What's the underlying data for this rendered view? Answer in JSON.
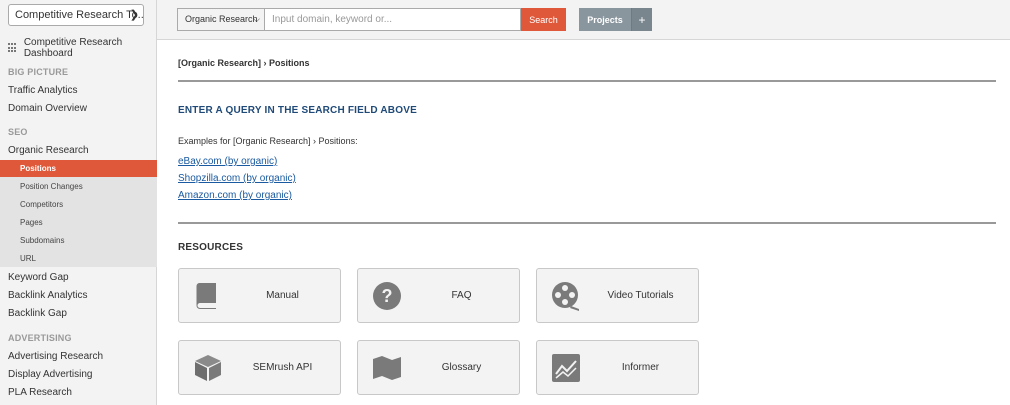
{
  "sidebar": {
    "tool_select": "Competitive Research To...",
    "dashboard": "Competitive Research Dashboard",
    "sections": [
      {
        "head": "BIG PICTURE",
        "items": [
          "Traffic Analytics",
          "Domain Overview"
        ]
      },
      {
        "head": "SEO",
        "items": [
          "Organic Research"
        ]
      }
    ],
    "organic_sub": [
      {
        "label": "Positions",
        "active": true
      },
      {
        "label": "Position Changes",
        "active": false
      },
      {
        "label": "Competitors",
        "active": false
      },
      {
        "label": "Pages",
        "active": false
      },
      {
        "label": "Subdomains",
        "active": false
      },
      {
        "label": "URL",
        "active": false
      }
    ],
    "seo_more": [
      "Keyword Gap",
      "Backlink Analytics",
      "Backlink Gap"
    ],
    "advertising": {
      "head": "ADVERTISING",
      "items": [
        "Advertising Research",
        "Display Advertising",
        "PLA Research"
      ]
    }
  },
  "topbar": {
    "db_select": "Organic Research",
    "search_placeholder": "Input domain, keyword or...",
    "search_label": "Search",
    "projects_label": "Projects",
    "plus_label": "+"
  },
  "main": {
    "breadcrumb": "[Organic Research] › Positions",
    "query_heading": "ENTER A QUERY IN THE SEARCH FIELD ABOVE",
    "examples_label": "Examples for [Organic Research] › Positions:",
    "examples": [
      "eBay.com (by organic)",
      "Shopzilla.com (by organic)",
      "Amazon.com (by organic)"
    ],
    "resources_heading": "RESOURCES",
    "resources": [
      {
        "label": "Manual",
        "icon": "book-icon"
      },
      {
        "label": "FAQ",
        "icon": "question-icon"
      },
      {
        "label": "Video Tutorials",
        "icon": "film-reel-icon"
      },
      {
        "label": "SEMrush API",
        "icon": "cube-icon"
      },
      {
        "label": "Glossary",
        "icon": "map-icon"
      },
      {
        "label": "Informer",
        "icon": "chart-icon"
      }
    ]
  },
  "colors": {
    "accent": "#e0583a",
    "link": "#1a5aa0",
    "heading": "#1f4a78",
    "button_gray": "#8a969e"
  }
}
